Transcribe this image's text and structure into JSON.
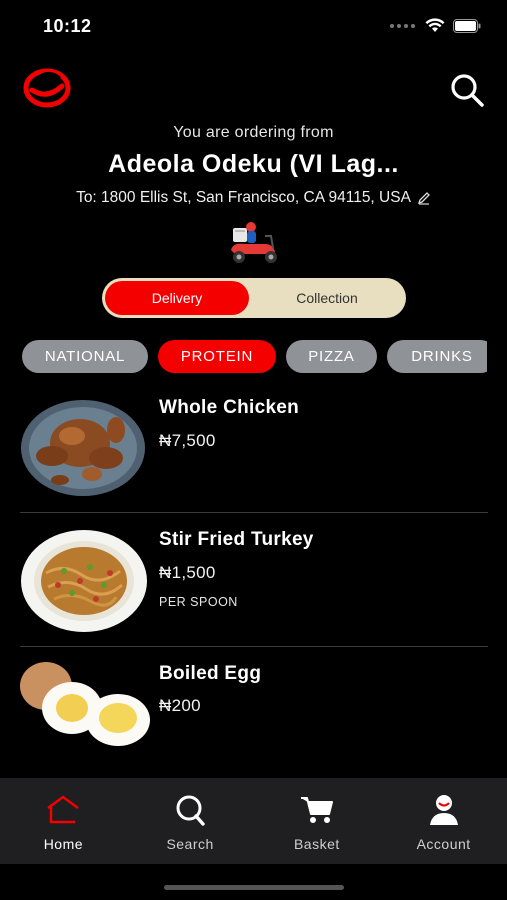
{
  "status_bar": {
    "time": "10:12"
  },
  "header": {
    "ordering_from": "You are ordering from",
    "restaurant": "Adeola Odeku (VI Lag...",
    "address": "To: 1800 Ellis St, San Francisco, CA 94115, USA"
  },
  "toggle": {
    "delivery": "Delivery",
    "collection": "Collection",
    "selected": "Delivery"
  },
  "categories": [
    {
      "label": "NATIONAL",
      "active": false
    },
    {
      "label": "PROTEIN",
      "active": true
    },
    {
      "label": "PIZZA",
      "active": false
    },
    {
      "label": "DRINKS",
      "active": false
    }
  ],
  "items": [
    {
      "name": "Whole Chicken",
      "price": "₦7,500",
      "unit": ""
    },
    {
      "name": "Stir Fried Turkey",
      "price": "₦1,500",
      "unit": "PER SPOON"
    },
    {
      "name": "Boiled Egg",
      "price": "₦200",
      "unit": ""
    }
  ],
  "tabbar": {
    "home": "Home",
    "search": "Search",
    "basket": "Basket",
    "account": "Account"
  },
  "colors": {
    "accent": "#f40000",
    "toggle_bg": "#e8dfc0",
    "chip_bg": "#8f9297",
    "tabbar_bg": "#1f1f21"
  },
  "icons": [
    "brand-logo",
    "search-icon",
    "edit-icon",
    "scooter-icon",
    "home-icon",
    "basket-icon",
    "account-icon"
  ]
}
